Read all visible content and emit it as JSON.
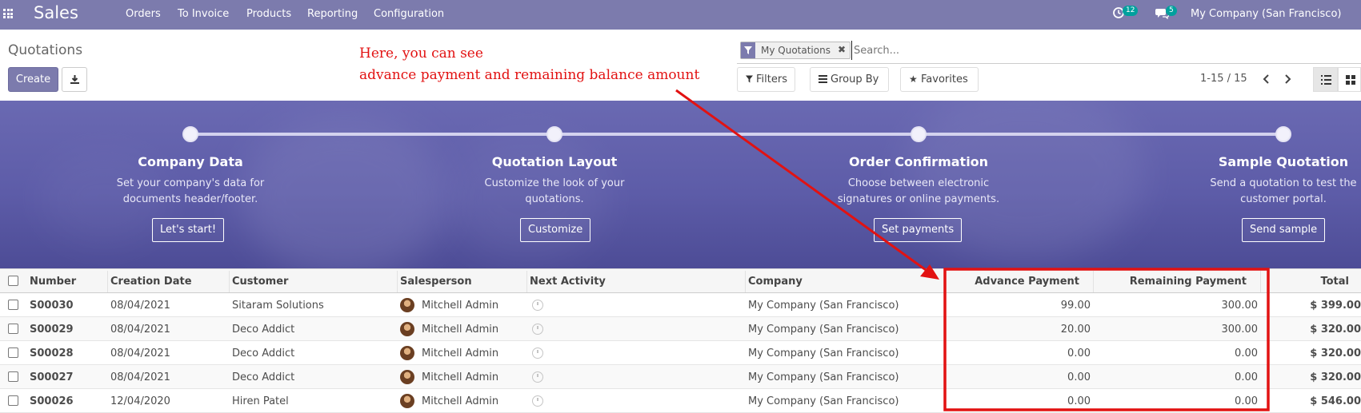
{
  "navbar": {
    "app_title": "Sales",
    "menu": [
      "Orders",
      "To Invoice",
      "Products",
      "Reporting",
      "Configuration"
    ],
    "activity_count": "12",
    "message_count": "5",
    "company": "My Company (San Francisco)"
  },
  "control_panel": {
    "breadcrumb": "Quotations",
    "create_label": "Create",
    "search_facet": "My Quotations",
    "search_placeholder": "Search...",
    "filters_label": "Filters",
    "groupby_label": "Group By",
    "favorites_label": "Favorites",
    "pager": "1-15 / 15"
  },
  "annotation": {
    "line1": "Here, you can see",
    "line2": "advance payment and remaining balance amount",
    "color": "#e21212"
  },
  "onboarding": {
    "steps": [
      {
        "title": "Company Data",
        "desc1": "Set your company's data for",
        "desc2": "documents header/footer.",
        "action": "Let's start!"
      },
      {
        "title": "Quotation Layout",
        "desc1": "Customize the look of your",
        "desc2": "quotations.",
        "action": "Customize"
      },
      {
        "title": "Order Confirmation",
        "desc1": "Choose between electronic",
        "desc2": "signatures or online payments.",
        "action": "Set payments"
      },
      {
        "title": "Sample Quotation",
        "desc1": "Send a quotation to test the",
        "desc2": "customer portal.",
        "action": "Send sample"
      }
    ]
  },
  "table": {
    "columns": [
      "Number",
      "Creation Date",
      "Customer",
      "Salesperson",
      "Next Activity",
      "Company",
      "Advance Payment",
      "Remaining Payment",
      "Total"
    ],
    "rows": [
      {
        "number": "S00030",
        "date": "08/04/2021",
        "customer": "Sitaram Solutions",
        "salesperson": "Mitchell Admin",
        "company": "My Company (San Francisco)",
        "advance": "99.00",
        "remaining": "300.00",
        "total": "$ 399.00"
      },
      {
        "number": "S00029",
        "date": "08/04/2021",
        "customer": "Deco Addict",
        "salesperson": "Mitchell Admin",
        "company": "My Company (San Francisco)",
        "advance": "20.00",
        "remaining": "300.00",
        "total": "$ 320.00"
      },
      {
        "number": "S00028",
        "date": "08/04/2021",
        "customer": "Deco Addict",
        "salesperson": "Mitchell Admin",
        "company": "My Company (San Francisco)",
        "advance": "0.00",
        "remaining": "0.00",
        "total": "$ 320.00"
      },
      {
        "number": "S00027",
        "date": "08/04/2021",
        "customer": "Deco Addict",
        "salesperson": "Mitchell Admin",
        "company": "My Company (San Francisco)",
        "advance": "0.00",
        "remaining": "0.00",
        "total": "$ 320.00"
      },
      {
        "number": "S00026",
        "date": "12/04/2020",
        "customer": "Hiren Patel",
        "salesperson": "Mitchell Admin",
        "company": "My Company (San Francisco)",
        "advance": "0.00",
        "remaining": "0.00",
        "total": "$ 546.00"
      }
    ]
  },
  "colors": {
    "brand": "#7c7bad",
    "badge": "#00a09d",
    "banner": "#5d5ca8"
  },
  "icons": [
    "apps-icon",
    "clock-icon",
    "chat-icon",
    "download-icon",
    "filter-icon",
    "list-icon",
    "grid-icon",
    "star-icon",
    "bars-icon",
    "chevron-left-icon",
    "chevron-right-icon"
  ]
}
